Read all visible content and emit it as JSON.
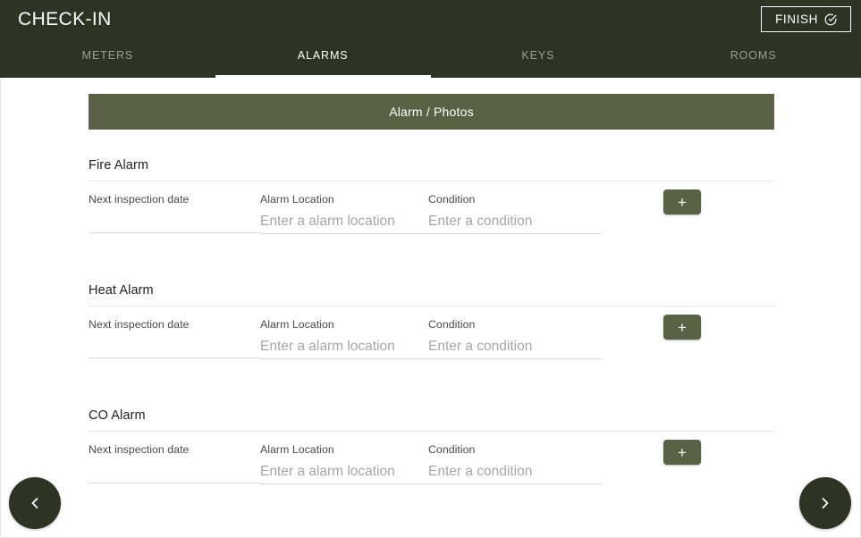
{
  "header": {
    "title": "CHECK-IN",
    "finish_label": "FINISH",
    "finish_icon": "check-circle-icon"
  },
  "tabs": [
    {
      "label": "METERS",
      "active": false
    },
    {
      "label": "ALARMS",
      "active": true
    },
    {
      "label": "KEYS",
      "active": false
    },
    {
      "label": "ROOMS",
      "active": false
    }
  ],
  "main": {
    "banner_label": "Alarm / Photos",
    "groups": [
      {
        "title": "Fire Alarm",
        "fields": {
          "date_label": "Next inspection date",
          "date_value": "",
          "date_placeholder": "",
          "location_label": "Alarm Location",
          "location_value": "",
          "location_placeholder": "Enter a alarm location",
          "condition_label": "Condition",
          "condition_value": "",
          "condition_placeholder": "Enter a condition"
        },
        "add_label": "+"
      },
      {
        "title": "Heat Alarm",
        "fields": {
          "date_label": "Next inspection date",
          "date_value": "",
          "date_placeholder": "",
          "location_label": "Alarm Location",
          "location_value": "",
          "location_placeholder": "Enter a alarm location",
          "condition_label": "Condition",
          "condition_value": "",
          "condition_placeholder": "Enter a condition"
        },
        "add_label": "+"
      },
      {
        "title": "CO Alarm",
        "fields": {
          "date_label": "Next inspection date",
          "date_value": "",
          "date_placeholder": "",
          "location_label": "Alarm Location",
          "location_value": "",
          "location_placeholder": "Enter a alarm location",
          "condition_label": "Condition",
          "condition_value": "",
          "condition_placeholder": "Enter a condition"
        },
        "add_label": "+"
      }
    ]
  },
  "navigation": {
    "prev_icon": "chevron-left-icon",
    "next_icon": "chevron-right-icon"
  },
  "colors": {
    "header_bg": "#2e3323",
    "accent_green": "#5a6145",
    "page_bg": "#ffffff",
    "divider": "#e6e6e6",
    "placeholder_text": "#a6a6a6"
  }
}
